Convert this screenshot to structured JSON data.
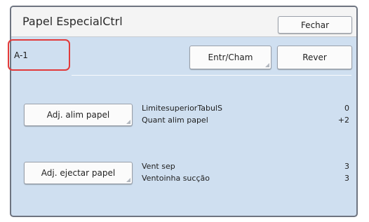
{
  "window": {
    "title": "Papel EspecialCtrl",
    "close_label": "Fechar"
  },
  "entry": {
    "id_value": "A-1",
    "entr_cham_label": "Entr/Cham",
    "rever_label": "Rever"
  },
  "feed": {
    "button_label": "Adj. alim papel",
    "rows": [
      {
        "label": "LimitesuperiorTabulS",
        "value": "0"
      },
      {
        "label": "Quant alim papel",
        "value": "+2"
      }
    ]
  },
  "eject": {
    "button_label": "Adj. ejectar papel",
    "rows": [
      {
        "label": "Vent sep",
        "value": "3"
      },
      {
        "label": "Ventoinha sucção",
        "value": "3"
      }
    ]
  },
  "colors": {
    "panel_background": "#cfdff0",
    "title_bar": "#f4f4f4",
    "highlight_ring": "#e23a3a",
    "panel_border": "#6e7480"
  }
}
